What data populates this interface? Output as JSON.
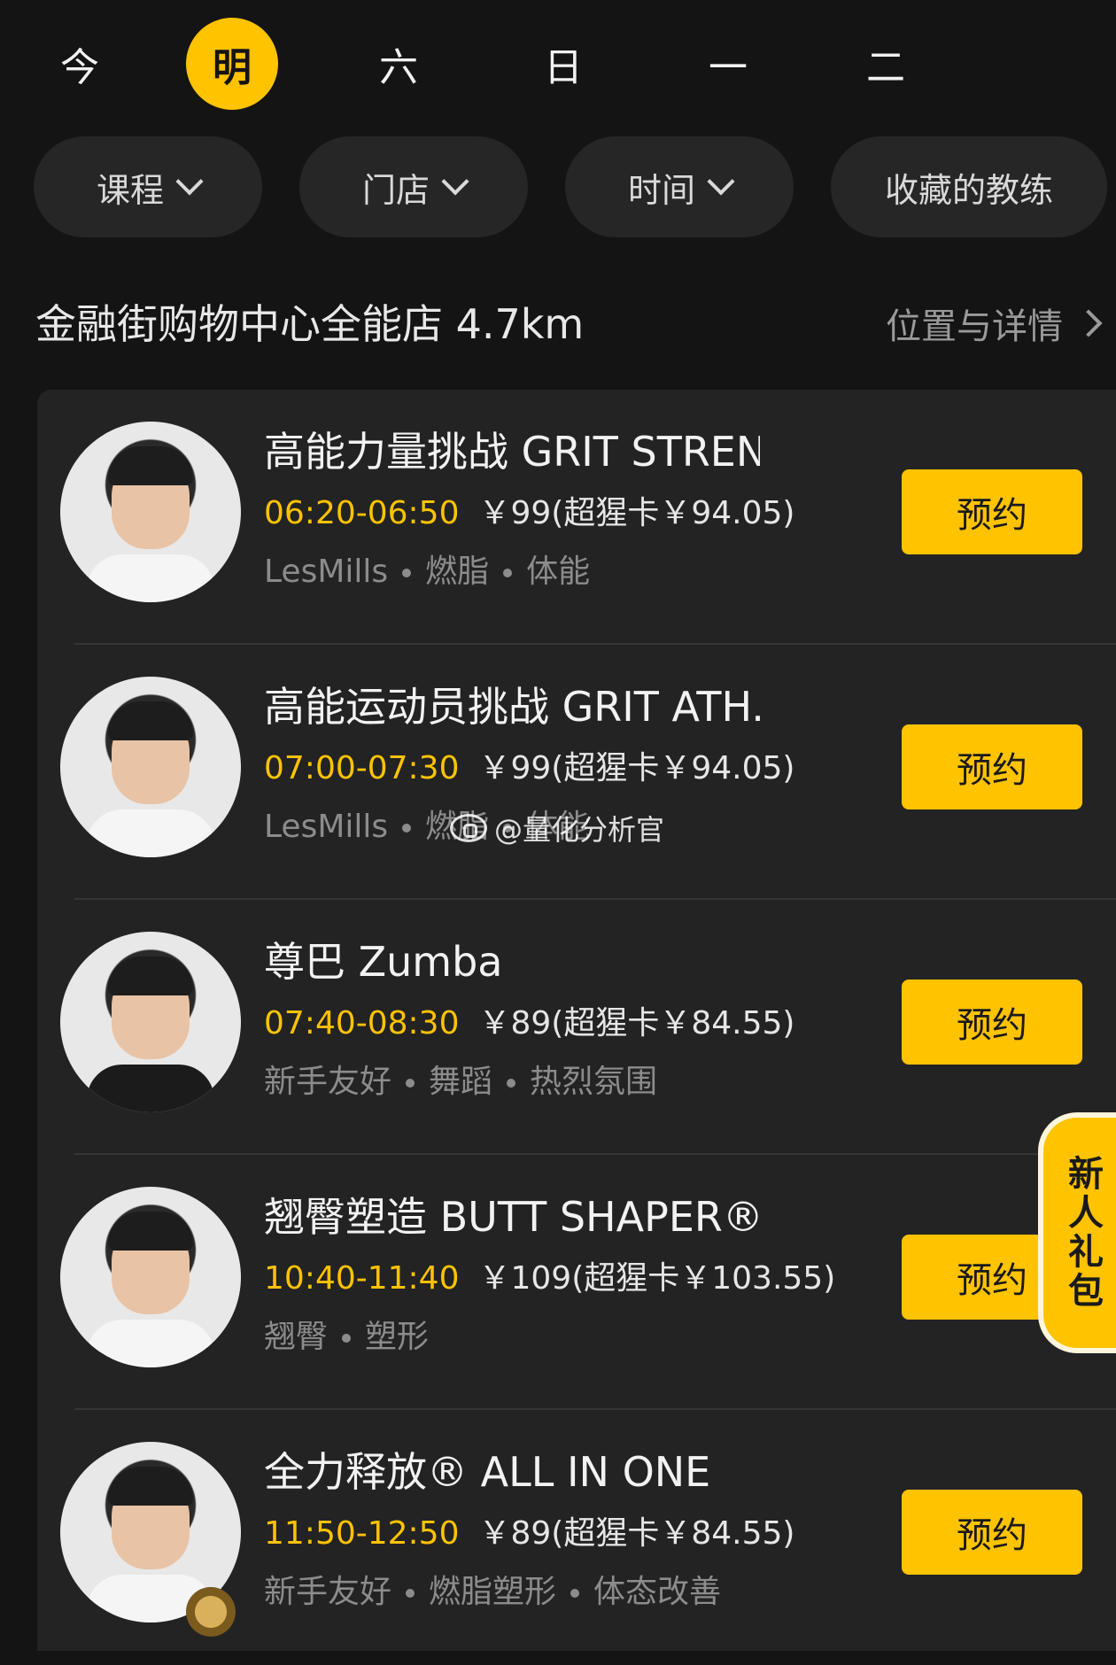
{
  "days": [
    "今",
    "明",
    "六",
    "日",
    "一",
    "二"
  ],
  "active_day_index": 1,
  "filters": [
    {
      "label": "课程",
      "has_dropdown": true
    },
    {
      "label": "门店",
      "has_dropdown": true
    },
    {
      "label": "时间",
      "has_dropdown": true
    },
    {
      "label": "收藏的教练",
      "has_dropdown": false
    }
  ],
  "store": {
    "name": "金融街购物中心全能店 4.7km",
    "link": "位置与详情"
  },
  "courses": [
    {
      "title": "高能力量挑战 GRIT STREN...",
      "time": "06:20-06:50",
      "price": "￥99(超猩卡￥94.05)",
      "tags": [
        "LesMills",
        "燃脂",
        "体能"
      ],
      "button": "预约"
    },
    {
      "title": "高能运动员挑战 GRIT ATH...",
      "time": "07:00-07:30",
      "price": "￥99(超猩卡￥94.05)",
      "tags": [
        "LesMills",
        "燃脂",
        "体能"
      ],
      "button": "预约"
    },
    {
      "title": "尊巴 Zumba",
      "time": "07:40-08:30",
      "price": "￥89(超猩卡￥84.55)",
      "tags": [
        "新手友好",
        "舞蹈",
        "热烈氛围"
      ],
      "button": "预约"
    },
    {
      "title": "翘臀塑造 BUTT SHAPER®",
      "time": "10:40-11:40",
      "price": "￥109(超猩卡￥103.55)",
      "tags": [
        "翘臀",
        "塑形"
      ],
      "button": "预约"
    },
    {
      "title": "全力释放® ALL IN ONE",
      "time": "11:50-12:50",
      "price": "￥89(超猩卡￥84.55)",
      "tags": [
        "新手友好",
        "燃脂塑形",
        "体态改善"
      ],
      "button": "预约"
    }
  ],
  "gift_badge": "新人礼包",
  "watermark": "@量化分析官",
  "colors": {
    "accent": "#ffc300",
    "background": "#141414",
    "card": "#232323"
  }
}
